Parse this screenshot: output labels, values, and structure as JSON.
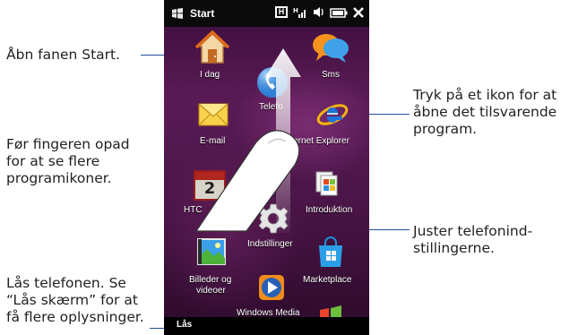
{
  "callouts": {
    "start": "Åbn fanen Start.",
    "swipe_l1": "Før fingeren opad",
    "swipe_l2": "for at se flere",
    "swipe_l3": "programikoner.",
    "lock_l1": "Lås telefonen. Se",
    "lock_l2": "“Lås skærm” for at",
    "lock_l3": "få flere oplysninger.",
    "tap_l1": "Tryk på et ikon for at",
    "tap_l2": "åbne det tilsvarende",
    "tap_l3": "program.",
    "adjust_l1": "Juster telefonind-",
    "adjust_l2": "stillingerne."
  },
  "phone": {
    "status": {
      "start_label": "Start"
    },
    "apps": {
      "idag": "I dag",
      "sms": "Sms",
      "telefon": "Telefo",
      "email": "E-mail",
      "ie": "Internet Explorer",
      "htc": "HTC",
      "introduktion": "Introduktion",
      "indstillinger": "Indstillinger",
      "billeder_l1": "Billeder og",
      "billeder_l2": "videoer",
      "marketplace": "Marketplace",
      "wmp": "Windows Media"
    },
    "bottom": {
      "lock_label": "Lås"
    }
  },
  "colors": {
    "callout_line": "#1f4e9a",
    "phone_bg": "#4a1547"
  }
}
